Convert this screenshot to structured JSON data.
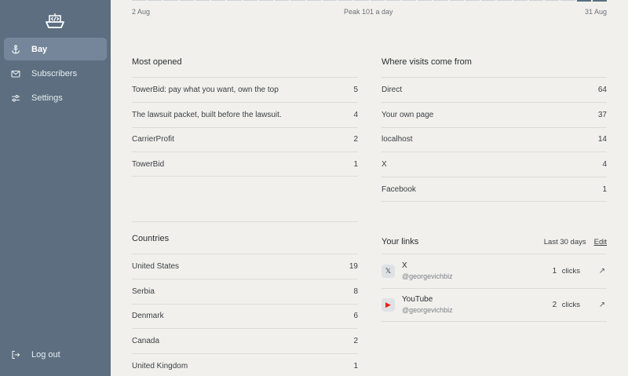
{
  "sidebar": {
    "logo_icon": "ship-code-icon",
    "items": [
      {
        "label": "Bay",
        "icon": "anchor-icon",
        "active": true
      },
      {
        "label": "Subscribers",
        "icon": "mail-icon",
        "active": false
      },
      {
        "label": "Settings",
        "icon": "sliders-icon",
        "active": false
      }
    ],
    "logout": {
      "label": "Log out",
      "icon": "logout-icon"
    }
  },
  "chart_axis": {
    "start": "2 Aug",
    "peak": "Peak 101 a day",
    "end": "31 Aug"
  },
  "most_opened": {
    "title": "Most opened",
    "rows": [
      {
        "label": "TowerBid: pay what you want, own the top",
        "value": "5"
      },
      {
        "label": "The lawsuit packet, built before the lawsuit.",
        "value": "4"
      },
      {
        "label": "CarrierProfit",
        "value": "2"
      },
      {
        "label": "TowerBid",
        "value": "1"
      }
    ]
  },
  "visits": {
    "title": "Where visits come from",
    "rows": [
      {
        "label": "Direct",
        "value": "64"
      },
      {
        "label": "Your own page",
        "value": "37"
      },
      {
        "label": "localhost",
        "value": "14"
      },
      {
        "label": "X",
        "value": "4"
      },
      {
        "label": "Facebook",
        "value": "1"
      }
    ]
  },
  "countries": {
    "title": "Countries",
    "rows": [
      {
        "label": "United States",
        "value": "19"
      },
      {
        "label": "Serbia",
        "value": "8"
      },
      {
        "label": "Denmark",
        "value": "6"
      },
      {
        "label": "Canada",
        "value": "2"
      },
      {
        "label": "United Kingdom",
        "value": "1"
      }
    ]
  },
  "links": {
    "title": "Your links",
    "range": "Last 30 days",
    "edit": "Edit",
    "clicks_label": "clicks",
    "items": [
      {
        "name": "X",
        "handle": "@georgevichbiz",
        "clicks": "1",
        "icon": "x-logo-icon",
        "glyph": "𝕏"
      },
      {
        "name": "YouTube",
        "handle": "@georgevichbiz",
        "clicks": "2",
        "icon": "youtube-icon",
        "glyph": "▶"
      }
    ]
  },
  "colors": {
    "sidebar": "#5c6e80",
    "sidebar_active": "#75869a",
    "background": "#f1f0ec",
    "youtube_red": "#e62117"
  }
}
